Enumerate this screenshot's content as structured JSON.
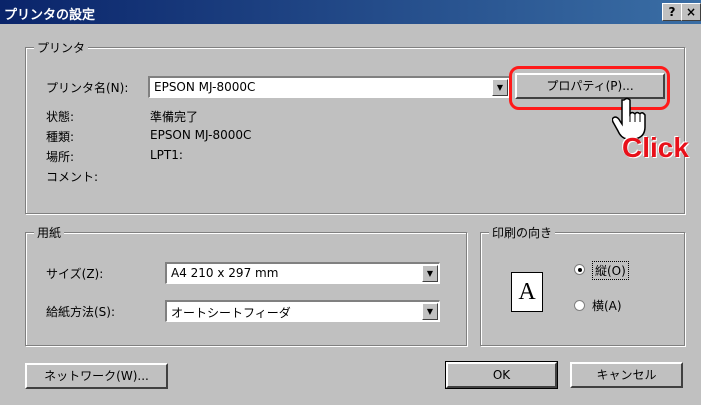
{
  "titlebar": {
    "title": "プリンタの設定",
    "help": "?",
    "close": "×"
  },
  "printer": {
    "legend": "プリンタ",
    "name_label": "プリンタ名(N):",
    "name_value": "EPSON MJ-8000C",
    "properties_button": "プロパティ(P)...",
    "status_label": "状態:",
    "status_value": "準備完了",
    "type_label": "種類:",
    "type_value": "EPSON MJ-8000C",
    "where_label": "場所:",
    "where_value": "LPT1:",
    "comment_label": "コメント:"
  },
  "paper": {
    "legend": "用紙",
    "size_label": "サイズ(Z):",
    "size_value": "A4 210 x 297 mm",
    "source_label": "給紙方法(S):",
    "source_value": "オートシートフィーダ"
  },
  "orientation": {
    "legend": "印刷の向き",
    "portrait": "縦(O)",
    "landscape": "横(A)",
    "selected": "portrait",
    "preview_glyph": "A"
  },
  "footer": {
    "network_button": "ネットワーク(W)...",
    "ok_button": "OK",
    "cancel_button": "キャンセル"
  },
  "annotation": {
    "click_text": "Click",
    "highlight_color": "#ff1a1a"
  }
}
